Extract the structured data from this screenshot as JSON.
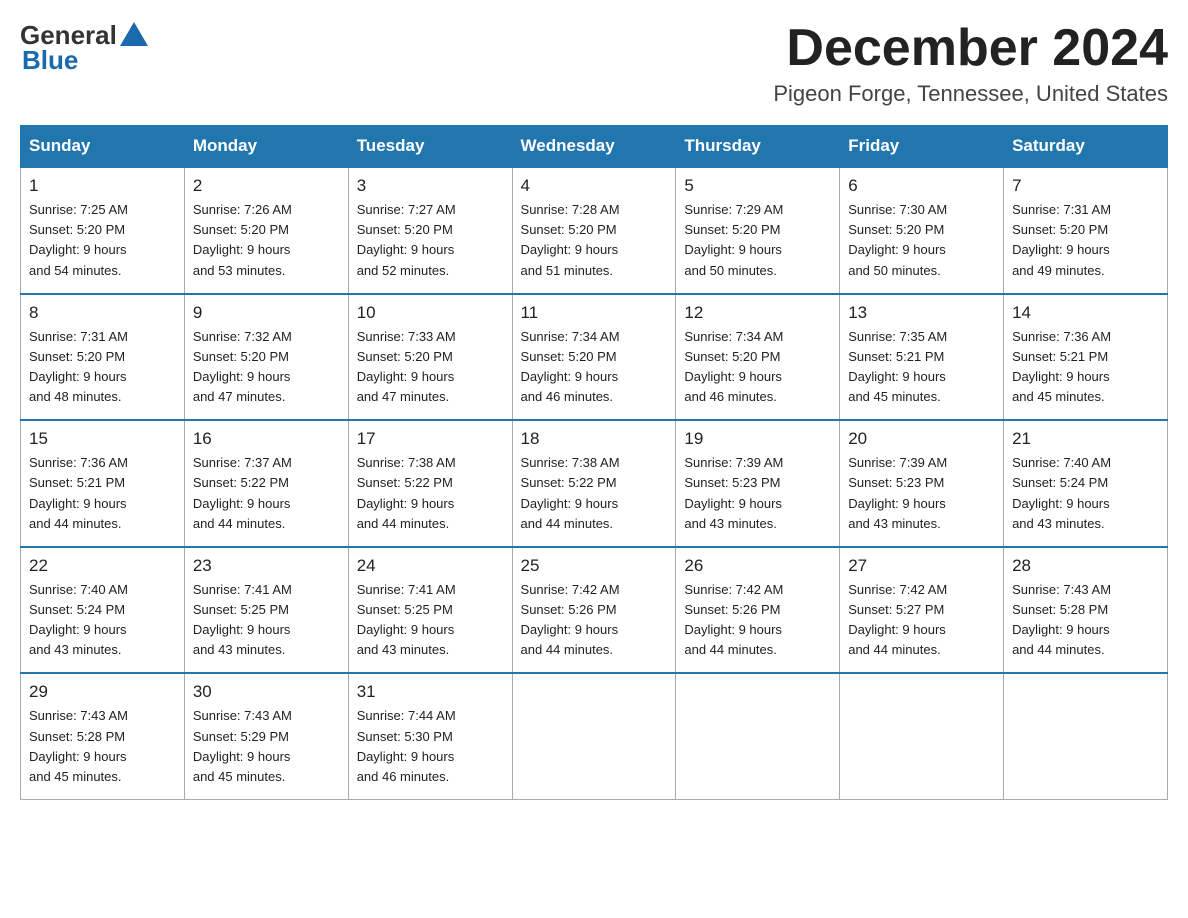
{
  "header": {
    "logo_general": "General",
    "logo_blue": "Blue",
    "month_title": "December 2024",
    "location": "Pigeon Forge, Tennessee, United States"
  },
  "days_of_week": [
    "Sunday",
    "Monday",
    "Tuesday",
    "Wednesday",
    "Thursday",
    "Friday",
    "Saturday"
  ],
  "weeks": [
    [
      {
        "day": "1",
        "sunrise": "7:25 AM",
        "sunset": "5:20 PM",
        "daylight": "9 hours and 54 minutes."
      },
      {
        "day": "2",
        "sunrise": "7:26 AM",
        "sunset": "5:20 PM",
        "daylight": "9 hours and 53 minutes."
      },
      {
        "day": "3",
        "sunrise": "7:27 AM",
        "sunset": "5:20 PM",
        "daylight": "9 hours and 52 minutes."
      },
      {
        "day": "4",
        "sunrise": "7:28 AM",
        "sunset": "5:20 PM",
        "daylight": "9 hours and 51 minutes."
      },
      {
        "day": "5",
        "sunrise": "7:29 AM",
        "sunset": "5:20 PM",
        "daylight": "9 hours and 50 minutes."
      },
      {
        "day": "6",
        "sunrise": "7:30 AM",
        "sunset": "5:20 PM",
        "daylight": "9 hours and 50 minutes."
      },
      {
        "day": "7",
        "sunrise": "7:31 AM",
        "sunset": "5:20 PM",
        "daylight": "9 hours and 49 minutes."
      }
    ],
    [
      {
        "day": "8",
        "sunrise": "7:31 AM",
        "sunset": "5:20 PM",
        "daylight": "9 hours and 48 minutes."
      },
      {
        "day": "9",
        "sunrise": "7:32 AM",
        "sunset": "5:20 PM",
        "daylight": "9 hours and 47 minutes."
      },
      {
        "day": "10",
        "sunrise": "7:33 AM",
        "sunset": "5:20 PM",
        "daylight": "9 hours and 47 minutes."
      },
      {
        "day": "11",
        "sunrise": "7:34 AM",
        "sunset": "5:20 PM",
        "daylight": "9 hours and 46 minutes."
      },
      {
        "day": "12",
        "sunrise": "7:34 AM",
        "sunset": "5:20 PM",
        "daylight": "9 hours and 46 minutes."
      },
      {
        "day": "13",
        "sunrise": "7:35 AM",
        "sunset": "5:21 PM",
        "daylight": "9 hours and 45 minutes."
      },
      {
        "day": "14",
        "sunrise": "7:36 AM",
        "sunset": "5:21 PM",
        "daylight": "9 hours and 45 minutes."
      }
    ],
    [
      {
        "day": "15",
        "sunrise": "7:36 AM",
        "sunset": "5:21 PM",
        "daylight": "9 hours and 44 minutes."
      },
      {
        "day": "16",
        "sunrise": "7:37 AM",
        "sunset": "5:22 PM",
        "daylight": "9 hours and 44 minutes."
      },
      {
        "day": "17",
        "sunrise": "7:38 AM",
        "sunset": "5:22 PM",
        "daylight": "9 hours and 44 minutes."
      },
      {
        "day": "18",
        "sunrise": "7:38 AM",
        "sunset": "5:22 PM",
        "daylight": "9 hours and 44 minutes."
      },
      {
        "day": "19",
        "sunrise": "7:39 AM",
        "sunset": "5:23 PM",
        "daylight": "9 hours and 43 minutes."
      },
      {
        "day": "20",
        "sunrise": "7:39 AM",
        "sunset": "5:23 PM",
        "daylight": "9 hours and 43 minutes."
      },
      {
        "day": "21",
        "sunrise": "7:40 AM",
        "sunset": "5:24 PM",
        "daylight": "9 hours and 43 minutes."
      }
    ],
    [
      {
        "day": "22",
        "sunrise": "7:40 AM",
        "sunset": "5:24 PM",
        "daylight": "9 hours and 43 minutes."
      },
      {
        "day": "23",
        "sunrise": "7:41 AM",
        "sunset": "5:25 PM",
        "daylight": "9 hours and 43 minutes."
      },
      {
        "day": "24",
        "sunrise": "7:41 AM",
        "sunset": "5:25 PM",
        "daylight": "9 hours and 43 minutes."
      },
      {
        "day": "25",
        "sunrise": "7:42 AM",
        "sunset": "5:26 PM",
        "daylight": "9 hours and 44 minutes."
      },
      {
        "day": "26",
        "sunrise": "7:42 AM",
        "sunset": "5:26 PM",
        "daylight": "9 hours and 44 minutes."
      },
      {
        "day": "27",
        "sunrise": "7:42 AM",
        "sunset": "5:27 PM",
        "daylight": "9 hours and 44 minutes."
      },
      {
        "day": "28",
        "sunrise": "7:43 AM",
        "sunset": "5:28 PM",
        "daylight": "9 hours and 44 minutes."
      }
    ],
    [
      {
        "day": "29",
        "sunrise": "7:43 AM",
        "sunset": "5:28 PM",
        "daylight": "9 hours and 45 minutes."
      },
      {
        "day": "30",
        "sunrise": "7:43 AM",
        "sunset": "5:29 PM",
        "daylight": "9 hours and 45 minutes."
      },
      {
        "day": "31",
        "sunrise": "7:44 AM",
        "sunset": "5:30 PM",
        "daylight": "9 hours and 46 minutes."
      },
      null,
      null,
      null,
      null
    ]
  ],
  "labels": {
    "sunrise": "Sunrise:",
    "sunset": "Sunset:",
    "daylight": "Daylight:"
  }
}
